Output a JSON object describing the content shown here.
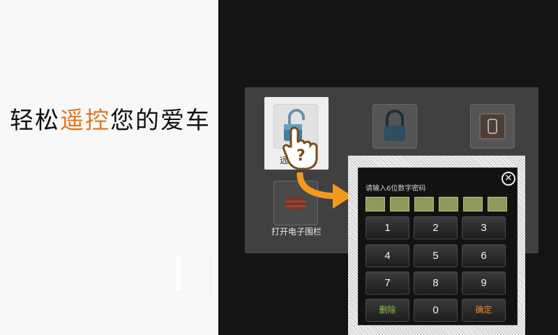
{
  "banner": {
    "slogan_part1": "轻松",
    "slogan_accent": "遥控",
    "slogan_part2": "您的爱车"
  },
  "menu": {
    "items": [
      {
        "label": "远程开锁",
        "icon": "unlock-icon"
      },
      {
        "label": "",
        "icon": "lock-icon"
      },
      {
        "label": "",
        "icon": "trunk-icon"
      },
      {
        "label": "打开电子围栏",
        "icon": "fence-icon"
      }
    ]
  },
  "keypad": {
    "title": "请输入6位数字密码",
    "close_icon": "close-icon",
    "pin_length": 6,
    "keys": [
      "1",
      "2",
      "3",
      "4",
      "5",
      "6",
      "7",
      "8",
      "9",
      "删除",
      "0",
      "确定"
    ],
    "colors": {
      "delete": "#8fc34a",
      "confirm": "#f08a1c",
      "pin_cell": "#8f9a5a"
    }
  },
  "colors": {
    "accent": "#e07820",
    "background": "#141414"
  }
}
